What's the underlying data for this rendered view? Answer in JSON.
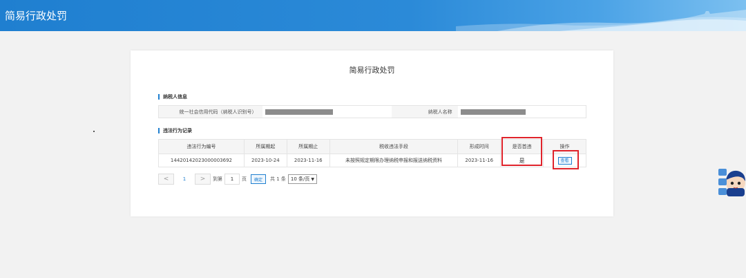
{
  "header": {
    "title": "简易行政处罚"
  },
  "card": {
    "title": "简易行政处罚"
  },
  "taxpayer_info": {
    "section_label": "纳税人信息",
    "credit_code_label": "统一社会信用代码（纳税人识别号）",
    "name_label": "纳税人名称"
  },
  "records": {
    "section_label": "违法行为记录",
    "columns": [
      "违法行为编号",
      "所属期起",
      "所属期止",
      "税收违法手段",
      "形成时间",
      "是否首违",
      "操作"
    ],
    "rows": [
      {
        "id": "14420142023000003692",
        "period_start": "2023-10-24",
        "period_end": "2023-11-16",
        "means": "未按照规定期限办理纳税申报和报送纳税资料",
        "formed": "2023-11-16",
        "first_violation": "是",
        "action": "查看"
      }
    ]
  },
  "pager": {
    "prev": "<",
    "current_page": "1",
    "next": ">",
    "goto_label": "到第",
    "page_input": "1",
    "page_unit": "页",
    "confirm": "确定",
    "total": "共 1 条",
    "page_size": "10 条/页"
  },
  "colors": {
    "brand_blue": "#1f7fd0",
    "highlight_red": "#e0232b"
  },
  "icons": {
    "wall": "great-wall-illustration",
    "mascot": "tax-mascot-icon"
  }
}
